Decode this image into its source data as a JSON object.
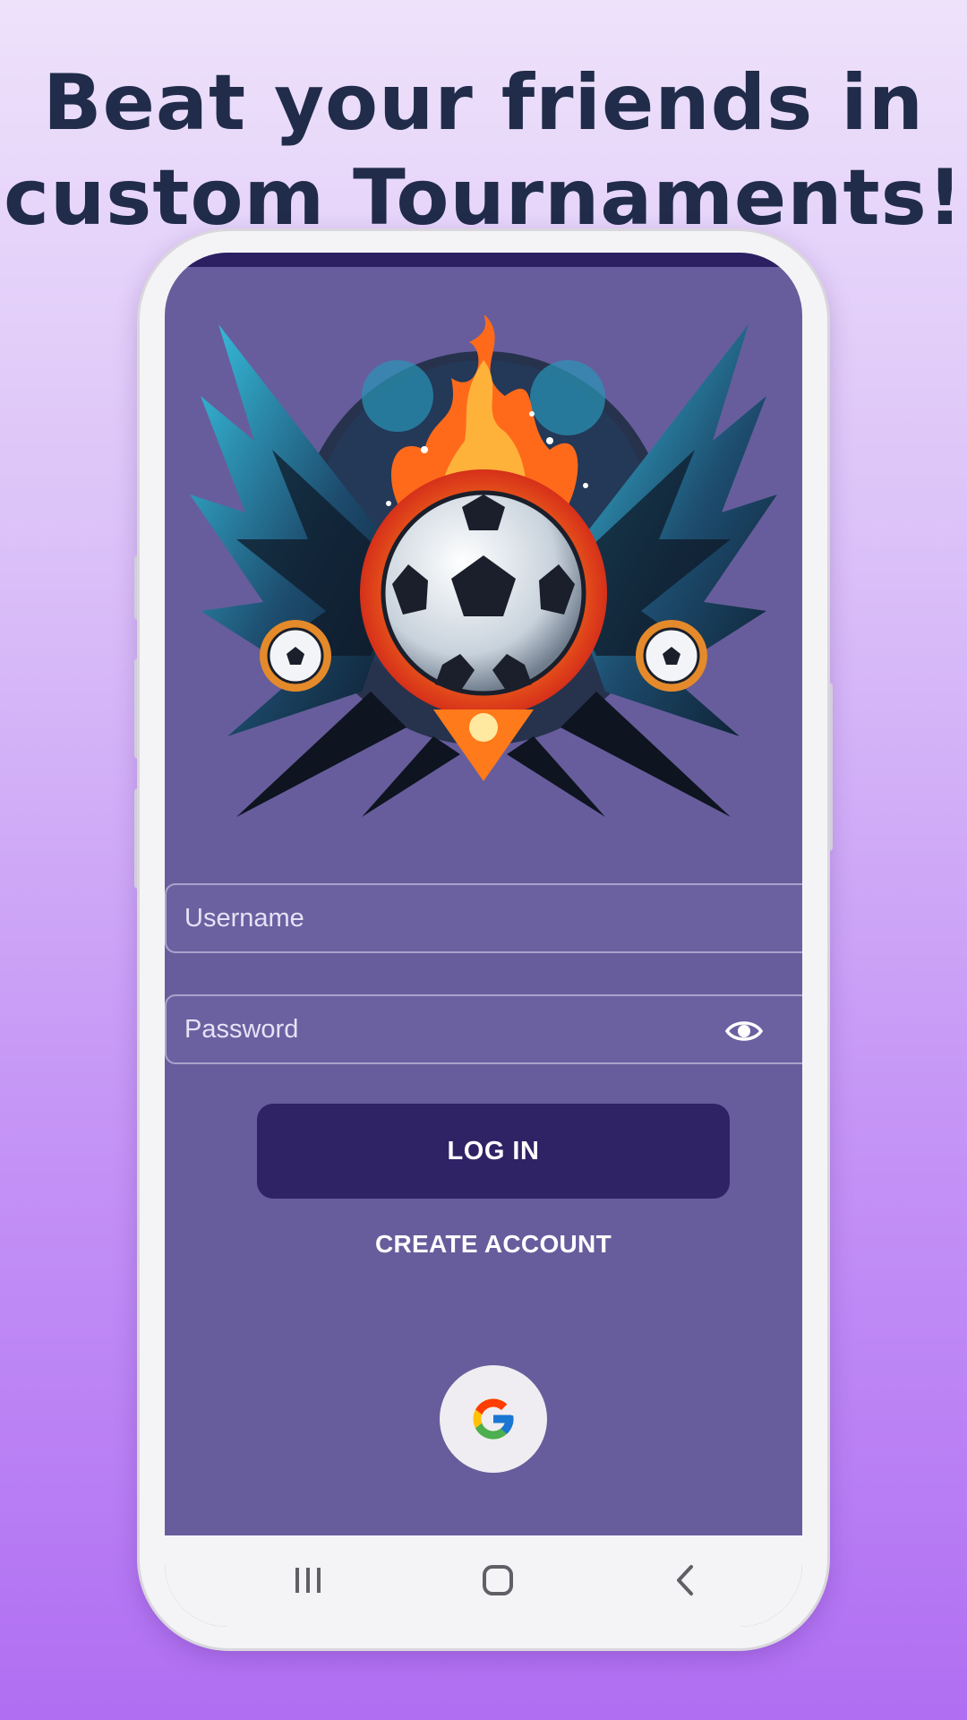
{
  "headline": {
    "line1": "Beat your friends in",
    "line2": "custom Tournaments!"
  },
  "login_form": {
    "username_placeholder": "Username",
    "password_placeholder": "Password",
    "login_label": "LOG IN",
    "create_account_label": "CREATE ACCOUNT"
  },
  "social_login": {
    "icon": "google-g-icon"
  },
  "nav_bar": {
    "icons": [
      "recent-apps-icon",
      "home-icon",
      "back-icon"
    ]
  },
  "logo": {
    "description_icon": "winged-flaming-soccer-ball-logo"
  },
  "colors": {
    "screen_bg": "#675d9c",
    "button_bg": "#2f2365",
    "headline": "#212c4a",
    "bg_top": "#eee2fb",
    "bg_bottom": "#b06ef2"
  }
}
